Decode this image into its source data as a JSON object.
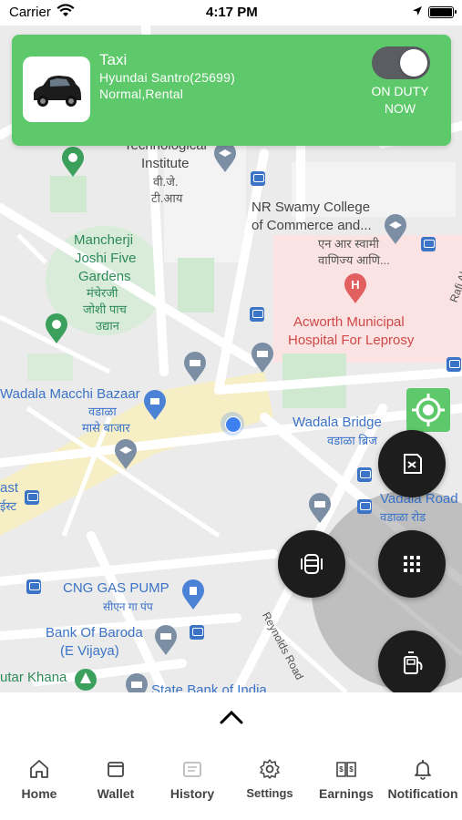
{
  "status_bar": {
    "carrier": "Carrier",
    "time": "4:17 PM"
  },
  "driver_card": {
    "vehicle_title": "Taxi",
    "vehicle_model": "Hyundai Santro(25699)",
    "vehicle_type": "Normal,Rental",
    "duty_status": "ON DUTY NOW",
    "duty_on": true,
    "card_color": "#5dc96a"
  },
  "map": {
    "labels": {
      "tech_institute": "Technological",
      "tech_institute2": "Institute",
      "tech_hindi": "वी.जे.",
      "tech_hindi2": "टी.आय",
      "nr_swamy": "NR Swamy College",
      "nr_swamy2": "of Commerce and...",
      "nr_swamy_hi": "एन आर स्वामी",
      "nr_swamy_hi2": "वाणिज्य आणि...",
      "mancherji": "Mancherji",
      "mancherji2": "Joshi Five",
      "mancherji3": "Gardens",
      "mancherji_hi": "मंचेरजी",
      "mancherji_hi2": "जोशी पाच",
      "mancherji_hi3": "उद्यान",
      "acworth": "Acworth Municipal",
      "acworth2": "Hospital For Leprosy",
      "rafi": "Rafi Ah",
      "wadala_macchi": "Wadala Macchi Bazaar",
      "wadala_hi": "वडाळा",
      "wadala_hi2": "मासे बाजार",
      "wadala_bridge": "Wadala Bridge",
      "wadala_bridge_hi": "वडाळा ब्रिज",
      "wadala_road": "Vadala Road",
      "wadala_road_hi": "वडाळा रोड",
      "ast": "ast",
      "ast_hi": "ईस्ट",
      "cng": "CNG GAS PUMP",
      "cng_hi": "सीएन गा पंप",
      "reynolds": "Reynolds Road",
      "bob": "Bank Of Baroda",
      "bob2": "(E Vijaya)",
      "sbi": "State Bank of India",
      "khana": "utar Khana"
    }
  },
  "actions": {
    "icons": [
      "locate-icon",
      "document-icon",
      "seat-icon",
      "grid-icon",
      "taxi-meter-icon"
    ]
  },
  "bottom_nav": {
    "items": [
      {
        "label": "Home",
        "icon": "home-icon"
      },
      {
        "label": "Wallet",
        "icon": "wallet-icon"
      },
      {
        "label": "History",
        "icon": "history-icon"
      },
      {
        "label": "Settings",
        "icon": "settings-icon"
      },
      {
        "label": "Earnings",
        "icon": "earnings-icon"
      },
      {
        "label": "Notification",
        "icon": "bell-icon"
      }
    ]
  }
}
